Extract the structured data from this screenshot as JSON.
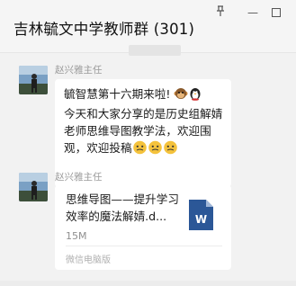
{
  "window": {
    "title": "吉林毓文中学教师群 (301)",
    "controls": {
      "pin_icon": "pin-icon",
      "minimize": "—",
      "maximize_icon": "maximize-icon"
    }
  },
  "messages": [
    {
      "sender": "赵兴雅主任",
      "avatar_icon": "avatar-image",
      "type": "text",
      "line1": "毓智慧第十六期来啦! ",
      "line2": "今天和大家分享的是历史组解婧老师思维导图教学法，欢迎围观，欢迎投稿",
      "emojis": [
        "monkey-emoji",
        "penguin-emoji",
        "awkward-face-emoji",
        "awkward-face-emoji",
        "awkward-face-emoji"
      ]
    },
    {
      "sender": "赵兴雅主任",
      "avatar_icon": "avatar-image",
      "type": "file",
      "file_name": "思维导图——提升学习效率的魔法解婧.d...",
      "file_size": "15M",
      "file_icon": "word-document-icon",
      "file_icon_letter": "W",
      "source": "微信电脑版"
    }
  ],
  "colors": {
    "chat_bg": "#f2f2f2",
    "bubble_bg": "#ffffff",
    "word_blue": "#2b5797"
  }
}
